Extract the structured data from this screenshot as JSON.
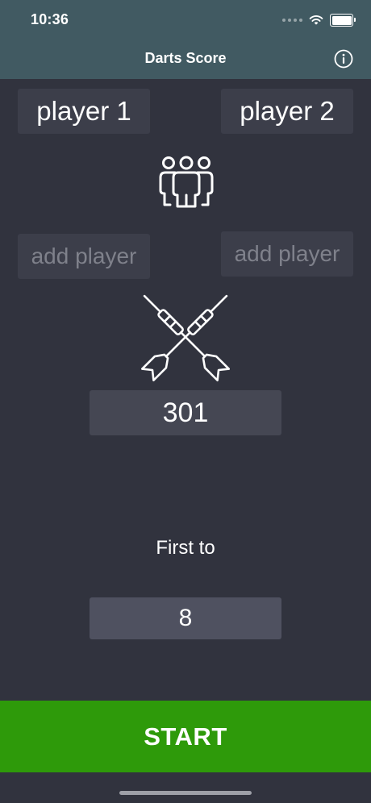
{
  "status_bar": {
    "time": "10:36"
  },
  "nav": {
    "title": "Darts Score",
    "info_icon": "info-icon"
  },
  "players": {
    "player1": "player 1",
    "player2": "player 2",
    "add_player_left_placeholder": "add player",
    "add_player_right_placeholder": "add player"
  },
  "icons": {
    "players": "people-group-icon",
    "darts": "crossed-darts-icon"
  },
  "game": {
    "score": "301",
    "first_to_label": "First to",
    "first_to_value": "8"
  },
  "actions": {
    "start_label": "START"
  },
  "colors": {
    "header_bg": "#415a62",
    "page_bg": "#31333e",
    "start_green": "#2e9a0a"
  }
}
